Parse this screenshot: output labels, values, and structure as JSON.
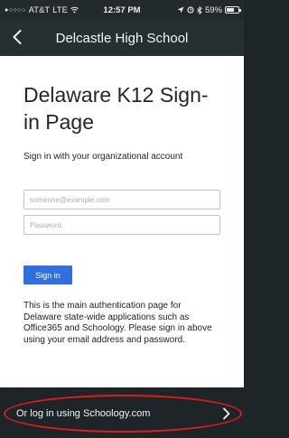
{
  "status_bar": {
    "signal_dots": "●○○○○",
    "carrier": "AT&T",
    "network": "LTE",
    "time": "12:57 PM",
    "battery": "59%"
  },
  "nav": {
    "title": "Delcastle High School",
    "back_icon": "chevron-left-icon"
  },
  "login": {
    "heading": "Delaware K12 Sign-in Page",
    "subtitle": "Sign in with your organizational account",
    "email_placeholder": "someone@example.com",
    "password_placeholder": "Password",
    "sign_in_label": "Sign in",
    "info_text": "This is the main authentication page for Delaware state-wide applications such as Office365 and Schoology. Please sign in above using your email address and password.",
    "accent_color": "#2f6fe0"
  },
  "footer": {
    "link_text": "Or log in using Schoology.com",
    "chevron_icon": "chevron-right-icon",
    "highlight_color": "#e21a1a"
  }
}
